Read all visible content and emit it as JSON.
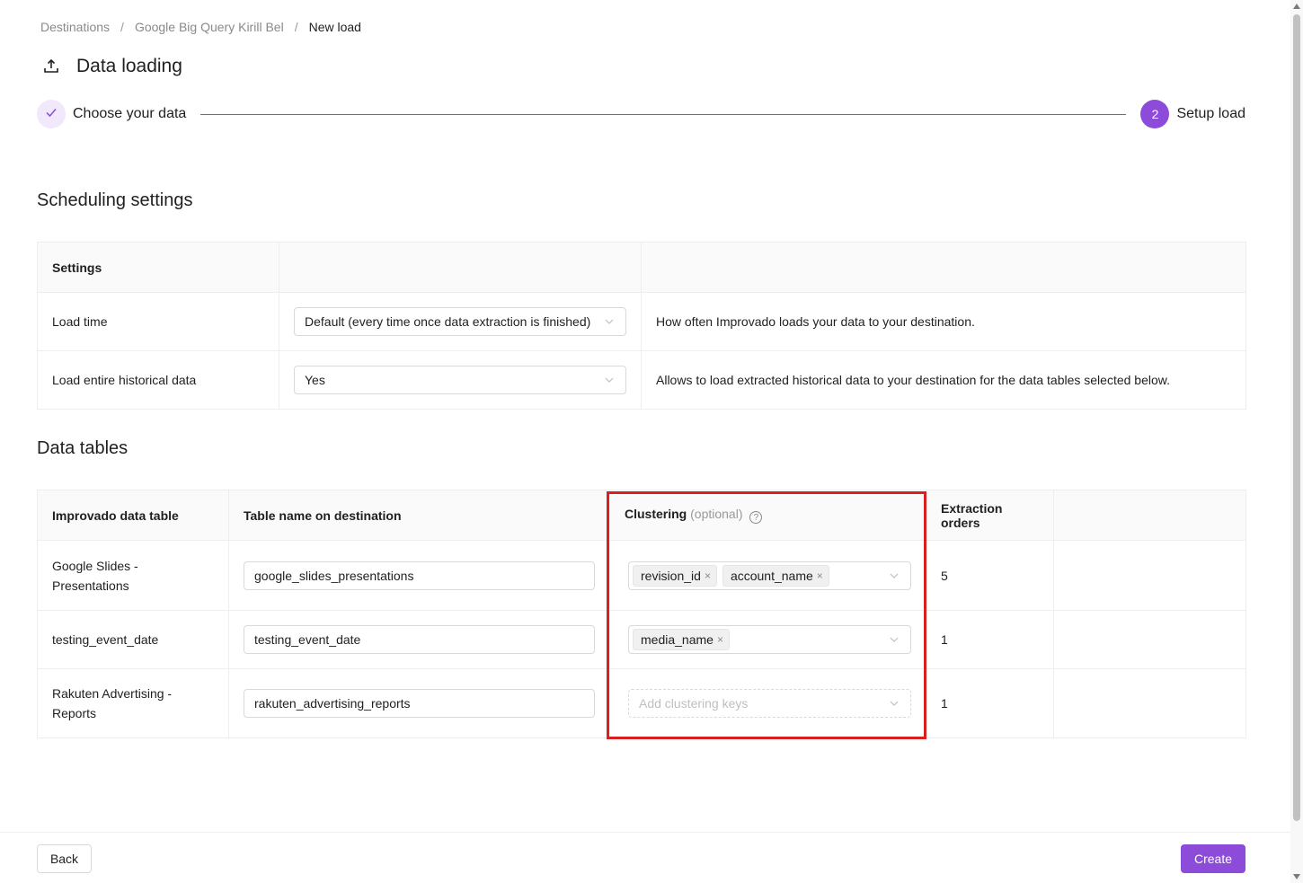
{
  "breadcrumb": {
    "items": [
      "Destinations",
      "Google Big Query Kirill Bel"
    ],
    "separator": "/",
    "current": "New load"
  },
  "header": {
    "icon": "upload-icon",
    "title": "Data loading"
  },
  "stepper": {
    "steps": [
      {
        "label": "Choose your data",
        "status": "done",
        "icon": "check-icon"
      },
      {
        "label": "Setup load",
        "status": "active",
        "number": "2"
      }
    ],
    "accent_color": "#8c4bd9"
  },
  "scheduling": {
    "title": "Scheduling settings",
    "header": "Settings",
    "rows": [
      {
        "label": "Load time",
        "value": "Default (every time once data extraction is finished)",
        "description": "How often Improvado loads your data to your destination."
      },
      {
        "label": "Load entire historical data",
        "value": "Yes",
        "description": "Allows to load extracted historical data to your destination for the data tables selected below."
      }
    ]
  },
  "data_tables": {
    "title": "Data tables",
    "columns": {
      "table": "Improvado data table",
      "destination": "Table name on destination",
      "clustering": "Clustering",
      "clustering_optional": "(optional)",
      "help": "?",
      "orders": "Extraction orders"
    },
    "clustering_placeholder": "Add clustering keys",
    "rows": [
      {
        "name_line1": "Google Slides -",
        "name_line2": "Presentations",
        "destination": "google_slides_presentations",
        "tag1": "revision_id",
        "tag2": "account_name",
        "orders": "5"
      },
      {
        "name_line1": "testing_event_date",
        "destination": "testing_event_date",
        "tag1": "media_name",
        "orders": "1"
      },
      {
        "name_line1": "Rakuten Advertising -",
        "name_line2": "Reports",
        "destination": "rakuten_advertising_reports",
        "orders": "1"
      }
    ],
    "tag_remove": "×"
  },
  "footer": {
    "back_label": "Back",
    "create_label": "Create"
  },
  "colors": {
    "accent": "#8c4bd9",
    "highlight": "#d92020"
  }
}
